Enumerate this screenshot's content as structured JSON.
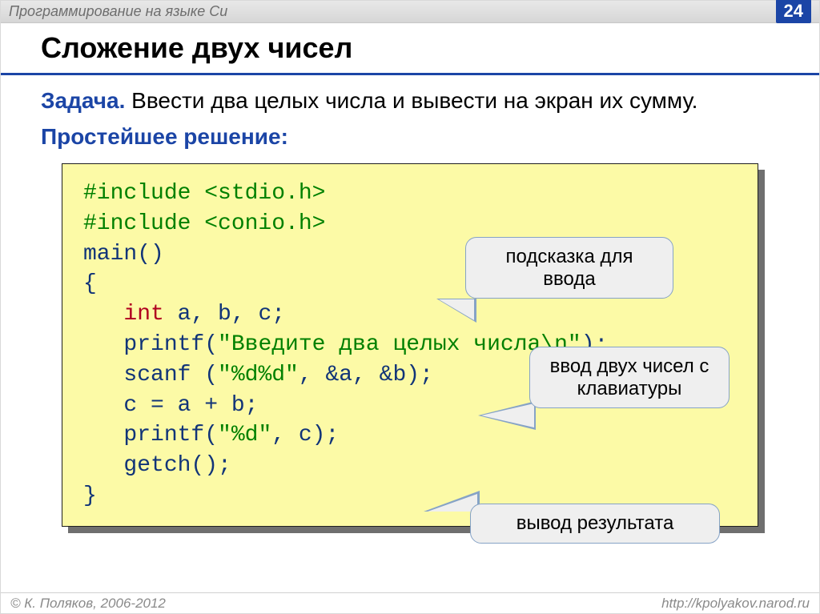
{
  "topbar": {
    "course_title": "Программирование на языке Си",
    "page_number": "24"
  },
  "title": "Сложение двух чисел",
  "task": {
    "label": "Задача.",
    "text": " Ввести два целых числа и вывести на экран их сумму."
  },
  "solution_label": "Простейшее решение:",
  "code": {
    "l1a": "#include <stdio.h>",
    "l2a": "#include <conio.h>",
    "l3a": "main()",
    "l4a": "{",
    "l5a": "   ",
    "l5b": "int",
    "l5c": " a, b, c;",
    "l6a": "   printf(",
    "l6b": "\"Введите два целых числа\\n\"",
    "l6c": ");",
    "l7a": "   scanf (",
    "l7b": "\"%d%d\"",
    "l7c": ", &a, &b);",
    "l8a": "   c = a + b;",
    "l9a": "   printf(",
    "l9b": "\"%d\"",
    "l9c": ", c);",
    "l10a": "   getch();",
    "l11a": "}"
  },
  "callouts": {
    "c1": "подсказка для ввода",
    "c2": "ввод двух чисел с клавиатуры",
    "c3": "вывод результата"
  },
  "footer": {
    "copyright": "© К. Поляков, 2006-2012",
    "url": "http://kpolyakov.narod.ru"
  }
}
